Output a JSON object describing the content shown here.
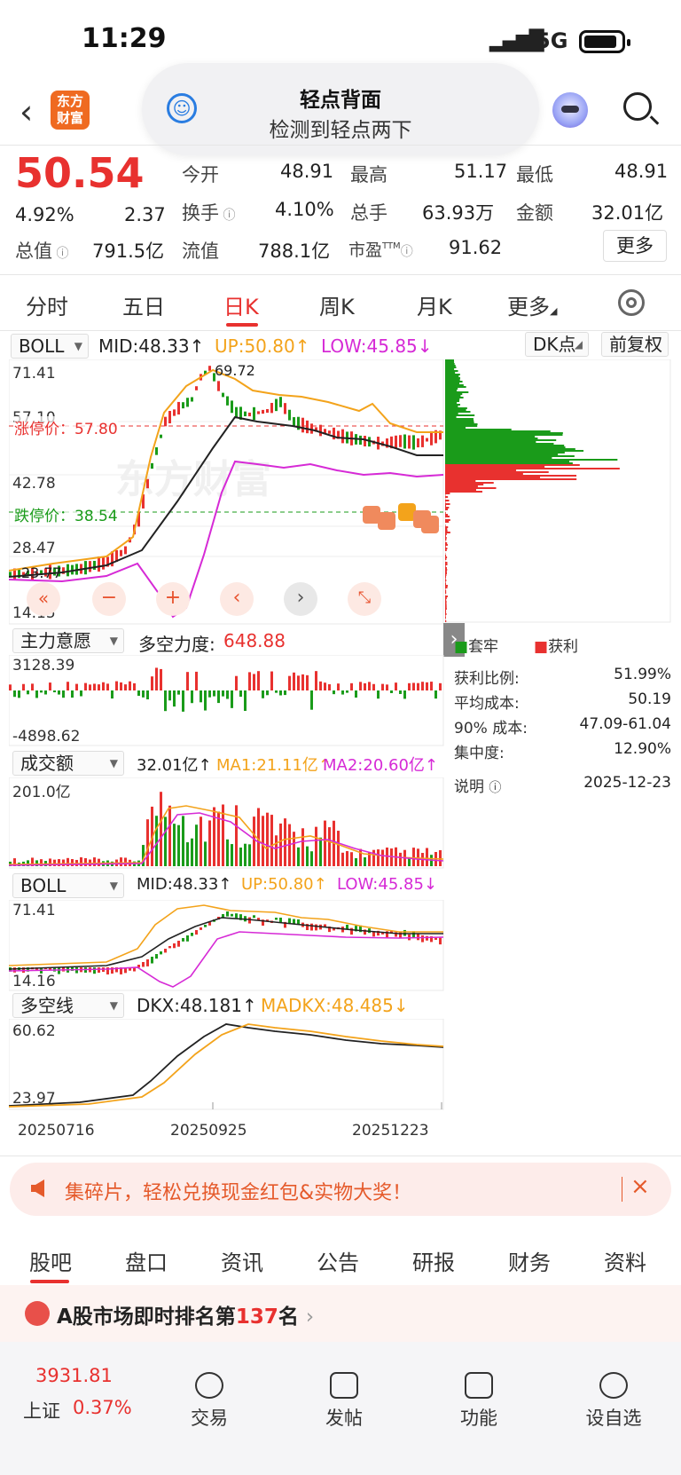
{
  "status_bar": {
    "time": "11:29",
    "network": "5G"
  },
  "header": {
    "logo_line1": "东方",
    "logo_line2": "财富",
    "pill_title": "轻点背面",
    "pill_subtitle": "检测到轻点两下"
  },
  "quote": {
    "price": "50.54",
    "change_pct": "4.92%",
    "change": "2.37",
    "open_label": "今开",
    "open": "48.91",
    "high_label": "最高",
    "high": "51.17",
    "low_label": "最低",
    "low": "48.91",
    "turnover_label": "换手",
    "turnover": "4.10%",
    "volume_label": "总手",
    "volume": "63.93万",
    "amount_label": "金额",
    "amount": "32.01亿",
    "mktcap_label": "总值",
    "mktcap": "791.5亿",
    "float_label": "流值",
    "float": "788.1亿",
    "pe_label": "市盈",
    "pe_sup": "TTM",
    "pe": "91.62",
    "more_button": "更多"
  },
  "period_tabs": [
    "分时",
    "五日",
    "日K",
    "周K",
    "月K",
    "更多"
  ],
  "active_period": "日K",
  "main_chart": {
    "indicator": "BOLL",
    "mid": "MID:48.33",
    "up": "UP:50.80",
    "low": "LOW:45.85",
    "dk_button": "DK点",
    "adjust_button": "前复权",
    "y_ticks": [
      "71.41",
      "57.10",
      "42.78",
      "28.47",
      "14.15"
    ],
    "limit_up": "涨停价：57.80",
    "limit_down": "跌停价：38.54",
    "high_mark": "69.72",
    "low_mark": "23.77",
    "watermark": "东方财富"
  },
  "chip_panel": {
    "legend_trapped": "套牢",
    "legend_profit": "获利",
    "rows": [
      {
        "label": "获利比例:",
        "value": "51.99%"
      },
      {
        "label": "平均成本:",
        "value": "50.19"
      },
      {
        "label": "90% 成本:",
        "value": "47.09-61.04"
      },
      {
        "label": "集中度:",
        "value": "12.90%"
      }
    ],
    "note_label": "说明",
    "date": "2025-12-23"
  },
  "fund_flow": {
    "indicator": "主力意愿",
    "title": "多空力度:",
    "value": "648.88",
    "y_max": "3128.39",
    "y_min": "-4898.62"
  },
  "amount_chart": {
    "indicator": "成交额",
    "value": "32.01亿",
    "ma1": "MA1:21.11亿",
    "ma2": "MA2:20.60亿",
    "y_max": "201.0亿"
  },
  "boll_chart": {
    "indicator": "BOLL",
    "mid": "MID:48.33",
    "up": "UP:50.80",
    "low": "LOW:45.85",
    "y_max": "71.41",
    "y_min": "14.16"
  },
  "dkx_chart": {
    "indicator": "多空线",
    "dkx": "DKX:48.181",
    "madkx": "MADKX:48.485",
    "y_max": "60.62",
    "y_min": "23.97",
    "dates": [
      "20250716",
      "20250925",
      "20251223"
    ]
  },
  "banner": {
    "text": "集碎片，轻松兑换现金红包&实物大奖！"
  },
  "bottom_tabs": [
    "股吧",
    "盘口",
    "资讯",
    "公告",
    "研报",
    "财务",
    "资料"
  ],
  "active_bottom_tab": "股吧",
  "rank": {
    "prefix": "A股市场即时排名第",
    "number": "137",
    "suffix": "名"
  },
  "bottom_bar": {
    "index_value": "3931.81",
    "index_name": "上证",
    "index_change": "0.37%",
    "items": [
      "交易",
      "发帖",
      "功能",
      "设自选"
    ]
  },
  "colors": {
    "red": "#e8312f",
    "green": "#1a9b1a",
    "orange": "#f3a31b",
    "magenta": "#d62ad6"
  }
}
